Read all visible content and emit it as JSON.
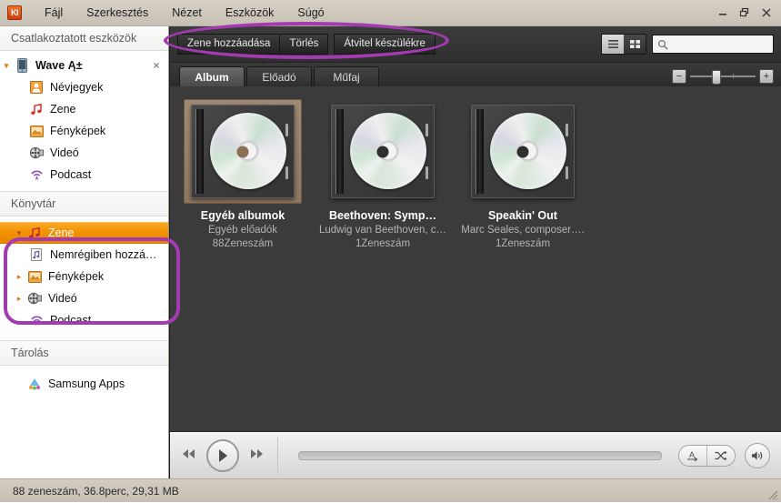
{
  "window": {
    "app_icon_text": "KI",
    "controls": {
      "minimize": "minimize-icon",
      "restore": "restore-icon",
      "close": "close-icon"
    }
  },
  "menu": {
    "items": [
      {
        "label": "Fájl"
      },
      {
        "label": "Szerkesztés"
      },
      {
        "label": "Nézet"
      },
      {
        "label": "Eszközök"
      },
      {
        "label": "Súgó"
      }
    ]
  },
  "sidebar": {
    "connected_header": "Csatlakoztatott eszközök",
    "library_header": "Könyvtár",
    "storage_header": "Tárolás",
    "device": {
      "label": "Wave Ą±",
      "icon": "phone-icon",
      "twisty": "▾",
      "close": "×"
    },
    "device_items": [
      {
        "label": "Névjegyek",
        "icon": "contacts-icon"
      },
      {
        "label": "Zene",
        "icon": "music-note-icon"
      },
      {
        "label": "Fényképek",
        "icon": "photos-icon"
      },
      {
        "label": "Videó",
        "icon": "video-reel-icon"
      },
      {
        "label": "Podcast",
        "icon": "podcast-icon"
      }
    ],
    "library_items": [
      {
        "label": "Zene",
        "icon": "music-note-icon",
        "twisty": "▾",
        "selected": true
      },
      {
        "label": "Nemrégiben hozzá…",
        "icon": "recent-music-icon",
        "twisty": "",
        "selected": false
      },
      {
        "label": "Fényképek",
        "icon": "photos-icon",
        "twisty": "▸",
        "selected": false
      },
      {
        "label": "Videó",
        "icon": "video-reel-icon",
        "twisty": "▸",
        "selected": false
      },
      {
        "label": "Podcast",
        "icon": "podcast-icon",
        "twisty": "",
        "selected": false
      }
    ],
    "storage_items": [
      {
        "label": "Samsung Apps",
        "icon": "samsung-apps-icon"
      }
    ]
  },
  "toolbar": {
    "add_music_label": "Zene hozzáadása",
    "delete_label": "Törlés",
    "transfer_label": "Átvitel készülékre",
    "list_view_icon": "list-view-icon",
    "grid_view_icon": "grid-view-icon",
    "search_icon": "search-icon",
    "search_value": "",
    "search_placeholder": ""
  },
  "tabs": [
    {
      "label": "Album",
      "active": true
    },
    {
      "label": "Előadó",
      "active": false
    },
    {
      "label": "Műfaj",
      "active": false
    }
  ],
  "zoom_control": {
    "minus_label": "−",
    "plus_label": "+",
    "value": 33
  },
  "albums": [
    {
      "title": "Egyéb albumok",
      "artist": "Egyéb előadók",
      "count": "88Zeneszám",
      "selected": true
    },
    {
      "title": "Beethoven: Symp…",
      "artist": "Ludwig van Beethoven, c…",
      "count": "1Zeneszám",
      "selected": false
    },
    {
      "title": "Speakin' Out",
      "artist": "Marc Seales, composer….",
      "count": "1Zeneszám",
      "selected": false
    }
  ],
  "player": {
    "prev_icon": "rewind-icon",
    "play_icon": "play-icon",
    "next_icon": "fast-forward-icon",
    "seek_position": 0,
    "repeat_icon": "repeat-all-icon",
    "shuffle_icon": "shuffle-icon",
    "volume_icon": "volume-icon"
  },
  "statusbar": {
    "text": "88 zeneszám, 36.8perc, 29,31 MB",
    "resize_grip_icon": "resize-grip-icon"
  },
  "annotations": {
    "color": "#a33bb0",
    "toolbar_highlight": "toolbar-buttons-highlight",
    "sidebar_highlight": "library-items-highlight"
  }
}
